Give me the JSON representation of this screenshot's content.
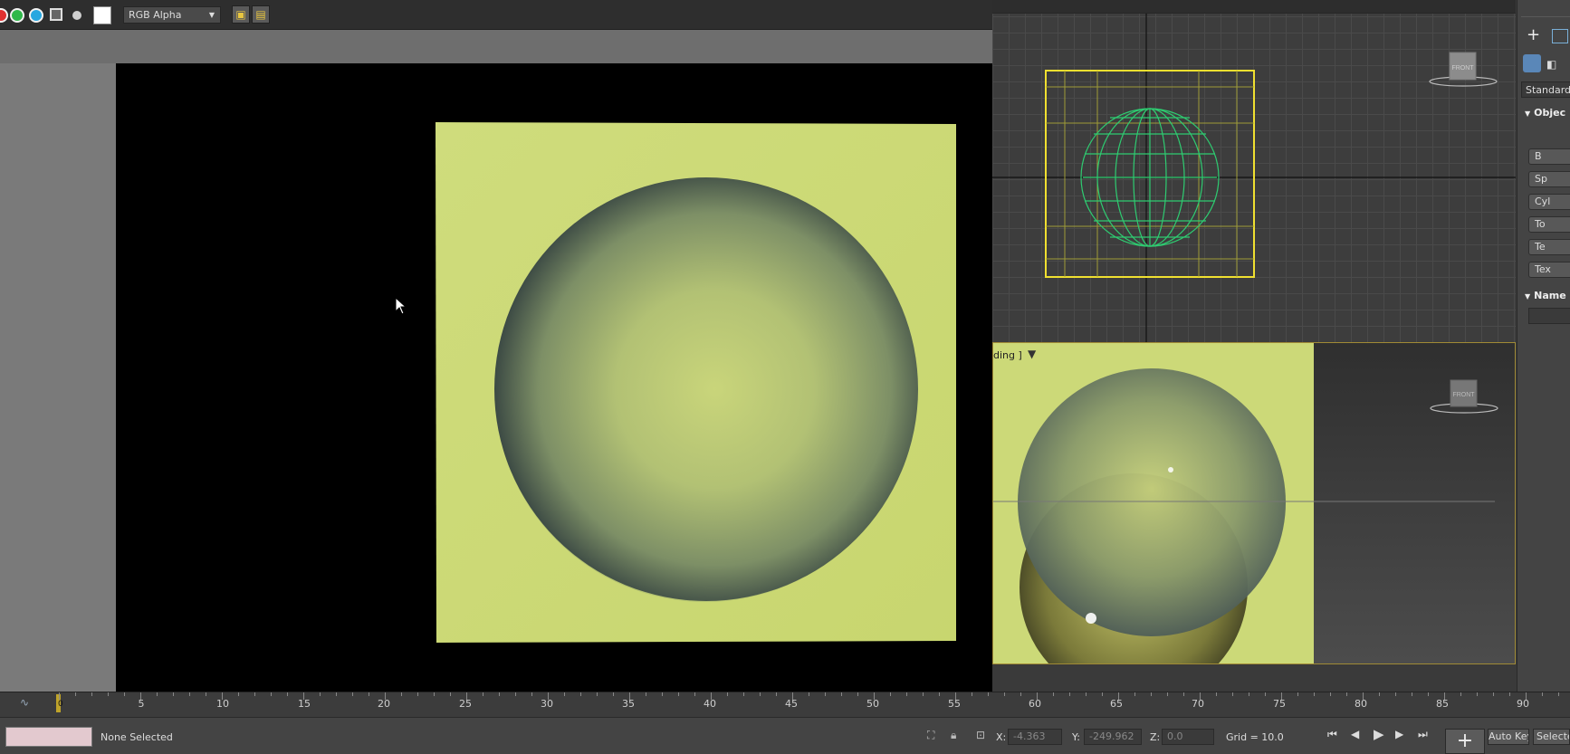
{
  "framebuffer": {
    "channel_select_value": "RGB Alpha",
    "channel_buttons": [
      {
        "name": "red-channel",
        "color": "#e03030"
      },
      {
        "name": "green-channel",
        "color": "#2fb84a"
      },
      {
        "name": "blue-channel",
        "color": "#27a7e0"
      },
      {
        "name": "mono-channel",
        "color": "#888888"
      },
      {
        "name": "alpha-channel",
        "color": "#cfcfcf"
      }
    ],
    "swatch_color": "#ffffff"
  },
  "command_panel": {
    "dropdown_value": "Standard",
    "rollout_object_type": "Objec",
    "rollout_name": "Name",
    "buttons": [
      "B",
      "Sp",
      "Cyl",
      "To",
      "Te",
      "Tex"
    ]
  },
  "viewports": {
    "top_viewcube_label": "FRONT",
    "bottom_viewcube_label": "FRONT",
    "bottom_label": "ding ]"
  },
  "timeline": {
    "current_frame": "0",
    "ticks": [
      "5",
      "10",
      "15",
      "20",
      "25",
      "30",
      "35",
      "40",
      "45",
      "50",
      "55",
      "60",
      "65",
      "70",
      "75",
      "80",
      "85",
      "90"
    ]
  },
  "status_bar": {
    "selection_text": "None Selected",
    "x_label": "X:",
    "x_value": "-4.363",
    "y_label": "Y:",
    "y_value": "-249.962",
    "z_label": "Z:",
    "z_value": "0.0",
    "grid_text": "Grid = 10.0",
    "auto_key_label": "Auto Key",
    "selected_label": "Selecte"
  },
  "colors": {
    "accent_yellow": "#f0e030",
    "wire_green": "#2ecc71",
    "plane_color": "#ccd978"
  }
}
